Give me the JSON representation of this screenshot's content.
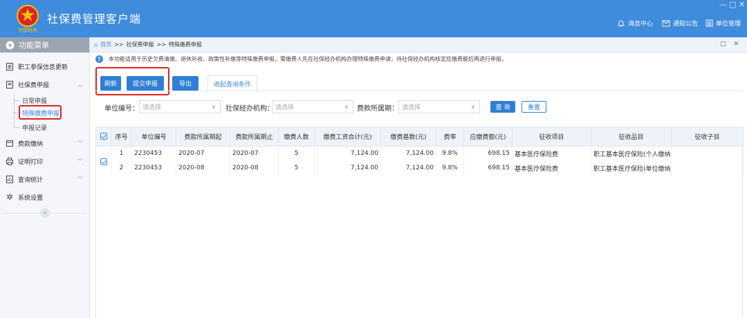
{
  "app": {
    "title": "社保费管理客户端",
    "logo_text": "中国税务",
    "window_controls": [
      "—",
      "□",
      "✕"
    ]
  },
  "header_nav": [
    {
      "label": "消息中心",
      "icon": "bell-icon"
    },
    {
      "label": "通知公告",
      "icon": "mail-icon"
    },
    {
      "label": "单位管理",
      "icon": "building-icon"
    }
  ],
  "sidebar": {
    "title": "功能菜单",
    "items": [
      {
        "label": "职工参保信息更新",
        "icon": "document-icon",
        "expanded": false
      },
      {
        "label": "社保费申报",
        "icon": "document-icon",
        "expanded": true,
        "children": [
          {
            "label": "日常申报",
            "active": false
          },
          {
            "label": "特殊缴费申报",
            "active": true
          },
          {
            "label": "申报记录",
            "active": false
          }
        ]
      },
      {
        "label": "费款缴纳",
        "icon": "wallet-icon",
        "expanded": false
      },
      {
        "label": "证明打印",
        "icon": "printer-icon",
        "expanded": false
      },
      {
        "label": "查询统计",
        "icon": "chart-icon",
        "expanded": false
      },
      {
        "label": "系统设置",
        "icon": "gear-icon",
        "expanded": false
      }
    ],
    "collapse_label": "«"
  },
  "breadcrumb": {
    "items": [
      "首页",
      "社保费申报",
      "特殊缴费申报"
    ],
    "separator": ">>",
    "controls": "□ ✕"
  },
  "notice": "本功能适用于历史欠费清缴、退休补收、政策性补缴等特殊缴费申报，需缴费人先在社保经办机构办理特殊缴费申请，待社保经办机构核定应缴费额后再进行申报。",
  "toolbar": {
    "refresh": "刷新",
    "submit": "提交申报",
    "export": "导出"
  },
  "tab_label": "收起查询条件",
  "filters": {
    "unit_no_label": "单位编号：",
    "unit_no_placeholder": "请选择",
    "agency_label": "社保经办机构：",
    "agency_placeholder": "请选择",
    "period_label": "费款所属期：",
    "period_placeholder": "请选择",
    "query": "查 询",
    "reset": "重置"
  },
  "table": {
    "columns": [
      "序号",
      "单位编号",
      "费款所属期起",
      "费款所属期止",
      "缴费人数",
      "缴费工资合计(元)",
      "缴费基数(元)",
      "费率",
      "应缴费额(元)",
      "征收项目",
      "征收品目",
      "征收子目"
    ],
    "rows": [
      {
        "no": "1",
        "unit": "2230453",
        "from": "2020-07",
        "to": "2020-07",
        "people": "5",
        "wage": "7,124.00",
        "base": "7,124.00",
        "rate": "9.8%",
        "due": "698.15",
        "item": "基本医疗保险费",
        "category": "职工基本医疗保险(个人缴纳)",
        "sub": ""
      },
      {
        "no": "2",
        "unit": "2230453",
        "from": "2020-08",
        "to": "2020-08",
        "people": "5",
        "wage": "7,124.00",
        "base": "7,124.00",
        "rate": "9.8%",
        "due": "698.15",
        "item": "基本医疗保险费",
        "category": "职工基本医疗保险(单位缴纳)",
        "sub": ""
      }
    ],
    "all_checked": true,
    "rows_checked": true
  },
  "colors": {
    "header": "#3f8bdc",
    "button": "#2f7fd6",
    "highlight": "#e02020"
  }
}
